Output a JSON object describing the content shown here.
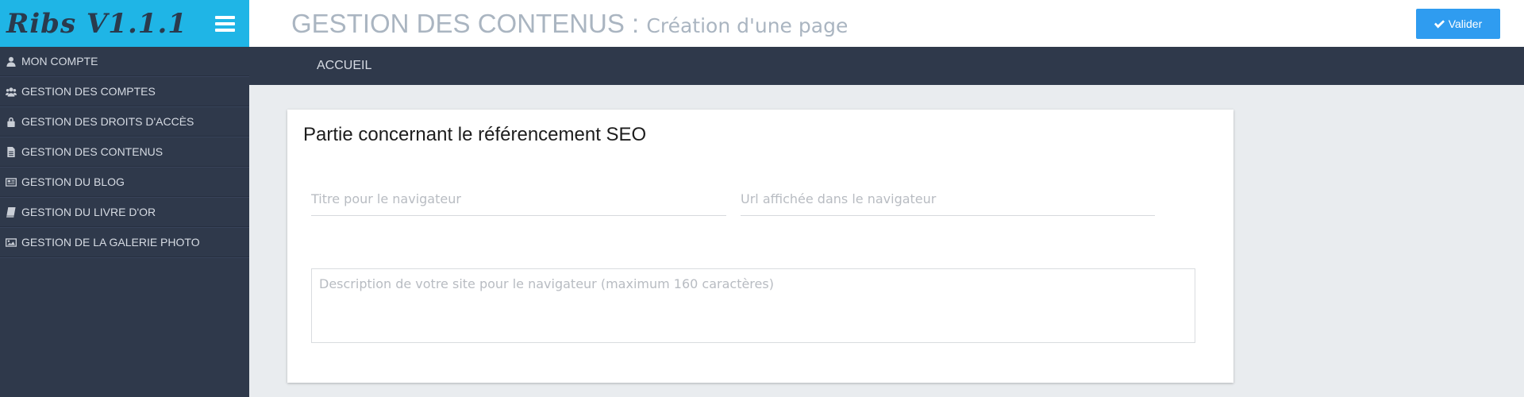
{
  "app": {
    "logo": "Ribs V1.1.1"
  },
  "header": {
    "title_main": "GESTION DES CONTENUS",
    "title_sep": " : ",
    "title_sub": "Création d'une page",
    "valider_label": "Valider"
  },
  "breadcrumb": {
    "home": "ACCUEIL"
  },
  "sidebar": {
    "items": [
      {
        "label": "MON COMPTE",
        "icon": "user-icon"
      },
      {
        "label": "GESTION DES COMPTES",
        "icon": "users-icon"
      },
      {
        "label": "GESTION DES DROITS D'ACCÈS",
        "icon": "lock-icon"
      },
      {
        "label": "GESTION DES CONTENUS",
        "icon": "file-icon"
      },
      {
        "label": "GESTION DU BLOG",
        "icon": "newspaper-icon"
      },
      {
        "label": "GESTION DU LIVRE D'OR",
        "icon": "book-icon"
      },
      {
        "label": "GESTION DE LA GALERIE PHOTO",
        "icon": "image-icon"
      }
    ]
  },
  "seo": {
    "heading": "Partie concernant le référencement SEO",
    "title_field": {
      "value": "",
      "placeholder": "Titre pour le navigateur"
    },
    "url_field": {
      "value": "",
      "placeholder": "Url affichée dans le navigateur"
    },
    "description_field": {
      "value": "",
      "placeholder": "Description de votre site pour le navigateur (maximum 160 caractères)"
    }
  },
  "colors": {
    "logo_bg": "#1fb5e6",
    "sidebar_bg": "#2f394b",
    "accent_button": "#2f9cf0",
    "title_gray": "#aab5c1",
    "page_bg": "#e9ecef"
  }
}
